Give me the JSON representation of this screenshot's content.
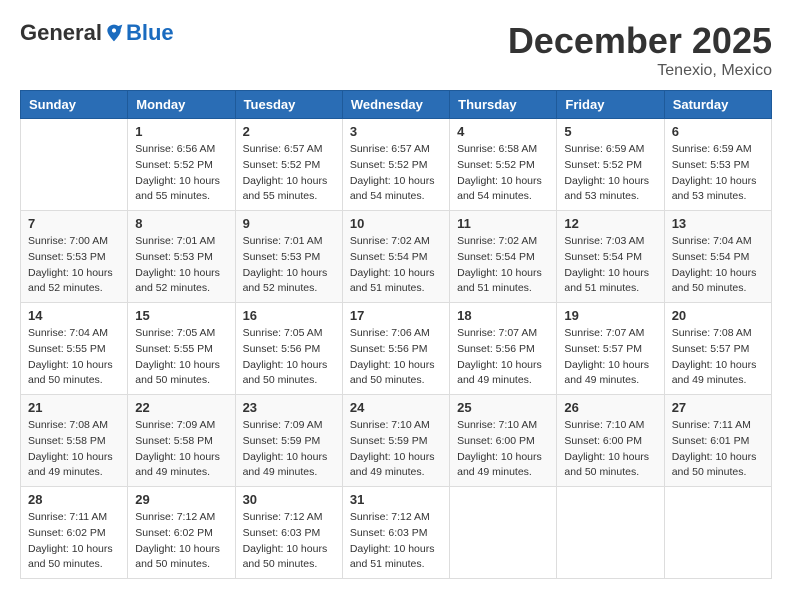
{
  "logo": {
    "general": "General",
    "blue": "Blue"
  },
  "header": {
    "month": "December 2025",
    "location": "Tenexio, Mexico"
  },
  "weekdays": [
    "Sunday",
    "Monday",
    "Tuesday",
    "Wednesday",
    "Thursday",
    "Friday",
    "Saturday"
  ],
  "weeks": [
    [
      {
        "day": "",
        "sunrise": "",
        "sunset": "",
        "daylight": ""
      },
      {
        "day": "1",
        "sunrise": "Sunrise: 6:56 AM",
        "sunset": "Sunset: 5:52 PM",
        "daylight": "Daylight: 10 hours and 55 minutes."
      },
      {
        "day": "2",
        "sunrise": "Sunrise: 6:57 AM",
        "sunset": "Sunset: 5:52 PM",
        "daylight": "Daylight: 10 hours and 55 minutes."
      },
      {
        "day": "3",
        "sunrise": "Sunrise: 6:57 AM",
        "sunset": "Sunset: 5:52 PM",
        "daylight": "Daylight: 10 hours and 54 minutes."
      },
      {
        "day": "4",
        "sunrise": "Sunrise: 6:58 AM",
        "sunset": "Sunset: 5:52 PM",
        "daylight": "Daylight: 10 hours and 54 minutes."
      },
      {
        "day": "5",
        "sunrise": "Sunrise: 6:59 AM",
        "sunset": "Sunset: 5:52 PM",
        "daylight": "Daylight: 10 hours and 53 minutes."
      },
      {
        "day": "6",
        "sunrise": "Sunrise: 6:59 AM",
        "sunset": "Sunset: 5:53 PM",
        "daylight": "Daylight: 10 hours and 53 minutes."
      }
    ],
    [
      {
        "day": "7",
        "sunrise": "Sunrise: 7:00 AM",
        "sunset": "Sunset: 5:53 PM",
        "daylight": "Daylight: 10 hours and 52 minutes."
      },
      {
        "day": "8",
        "sunrise": "Sunrise: 7:01 AM",
        "sunset": "Sunset: 5:53 PM",
        "daylight": "Daylight: 10 hours and 52 minutes."
      },
      {
        "day": "9",
        "sunrise": "Sunrise: 7:01 AM",
        "sunset": "Sunset: 5:53 PM",
        "daylight": "Daylight: 10 hours and 52 minutes."
      },
      {
        "day": "10",
        "sunrise": "Sunrise: 7:02 AM",
        "sunset": "Sunset: 5:54 PM",
        "daylight": "Daylight: 10 hours and 51 minutes."
      },
      {
        "day": "11",
        "sunrise": "Sunrise: 7:02 AM",
        "sunset": "Sunset: 5:54 PM",
        "daylight": "Daylight: 10 hours and 51 minutes."
      },
      {
        "day": "12",
        "sunrise": "Sunrise: 7:03 AM",
        "sunset": "Sunset: 5:54 PM",
        "daylight": "Daylight: 10 hours and 51 minutes."
      },
      {
        "day": "13",
        "sunrise": "Sunrise: 7:04 AM",
        "sunset": "Sunset: 5:54 PM",
        "daylight": "Daylight: 10 hours and 50 minutes."
      }
    ],
    [
      {
        "day": "14",
        "sunrise": "Sunrise: 7:04 AM",
        "sunset": "Sunset: 5:55 PM",
        "daylight": "Daylight: 10 hours and 50 minutes."
      },
      {
        "day": "15",
        "sunrise": "Sunrise: 7:05 AM",
        "sunset": "Sunset: 5:55 PM",
        "daylight": "Daylight: 10 hours and 50 minutes."
      },
      {
        "day": "16",
        "sunrise": "Sunrise: 7:05 AM",
        "sunset": "Sunset: 5:56 PM",
        "daylight": "Daylight: 10 hours and 50 minutes."
      },
      {
        "day": "17",
        "sunrise": "Sunrise: 7:06 AM",
        "sunset": "Sunset: 5:56 PM",
        "daylight": "Daylight: 10 hours and 50 minutes."
      },
      {
        "day": "18",
        "sunrise": "Sunrise: 7:07 AM",
        "sunset": "Sunset: 5:56 PM",
        "daylight": "Daylight: 10 hours and 49 minutes."
      },
      {
        "day": "19",
        "sunrise": "Sunrise: 7:07 AM",
        "sunset": "Sunset: 5:57 PM",
        "daylight": "Daylight: 10 hours and 49 minutes."
      },
      {
        "day": "20",
        "sunrise": "Sunrise: 7:08 AM",
        "sunset": "Sunset: 5:57 PM",
        "daylight": "Daylight: 10 hours and 49 minutes."
      }
    ],
    [
      {
        "day": "21",
        "sunrise": "Sunrise: 7:08 AM",
        "sunset": "Sunset: 5:58 PM",
        "daylight": "Daylight: 10 hours and 49 minutes."
      },
      {
        "day": "22",
        "sunrise": "Sunrise: 7:09 AM",
        "sunset": "Sunset: 5:58 PM",
        "daylight": "Daylight: 10 hours and 49 minutes."
      },
      {
        "day": "23",
        "sunrise": "Sunrise: 7:09 AM",
        "sunset": "Sunset: 5:59 PM",
        "daylight": "Daylight: 10 hours and 49 minutes."
      },
      {
        "day": "24",
        "sunrise": "Sunrise: 7:10 AM",
        "sunset": "Sunset: 5:59 PM",
        "daylight": "Daylight: 10 hours and 49 minutes."
      },
      {
        "day": "25",
        "sunrise": "Sunrise: 7:10 AM",
        "sunset": "Sunset: 6:00 PM",
        "daylight": "Daylight: 10 hours and 49 minutes."
      },
      {
        "day": "26",
        "sunrise": "Sunrise: 7:10 AM",
        "sunset": "Sunset: 6:00 PM",
        "daylight": "Daylight: 10 hours and 50 minutes."
      },
      {
        "day": "27",
        "sunrise": "Sunrise: 7:11 AM",
        "sunset": "Sunset: 6:01 PM",
        "daylight": "Daylight: 10 hours and 50 minutes."
      }
    ],
    [
      {
        "day": "28",
        "sunrise": "Sunrise: 7:11 AM",
        "sunset": "Sunset: 6:02 PM",
        "daylight": "Daylight: 10 hours and 50 minutes."
      },
      {
        "day": "29",
        "sunrise": "Sunrise: 7:12 AM",
        "sunset": "Sunset: 6:02 PM",
        "daylight": "Daylight: 10 hours and 50 minutes."
      },
      {
        "day": "30",
        "sunrise": "Sunrise: 7:12 AM",
        "sunset": "Sunset: 6:03 PM",
        "daylight": "Daylight: 10 hours and 50 minutes."
      },
      {
        "day": "31",
        "sunrise": "Sunrise: 7:12 AM",
        "sunset": "Sunset: 6:03 PM",
        "daylight": "Daylight: 10 hours and 51 minutes."
      },
      {
        "day": "",
        "sunrise": "",
        "sunset": "",
        "daylight": ""
      },
      {
        "day": "",
        "sunrise": "",
        "sunset": "",
        "daylight": ""
      },
      {
        "day": "",
        "sunrise": "",
        "sunset": "",
        "daylight": ""
      }
    ]
  ]
}
